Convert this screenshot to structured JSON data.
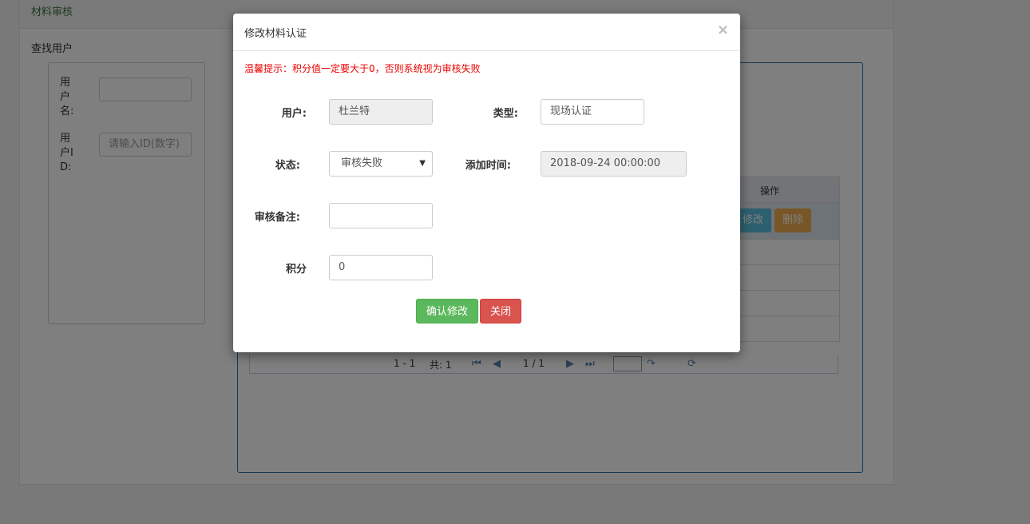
{
  "page": {
    "panel_title": "材料审核",
    "search_title": "查找用户",
    "username_label": "用户名:",
    "userid_label": "用户ID:",
    "userid_placeholder": "请输入ID(数字)",
    "grid": {
      "action_header": "操作",
      "edit_label": "修改",
      "delete_label": "删除",
      "pager": {
        "range": "1 - 1",
        "total": "共: 1",
        "page": "1 / 1"
      }
    }
  },
  "modal": {
    "title": "修改材料认证",
    "close_glyph": "×",
    "tip": "温馨提示：积分值一定要大于0，否则系统视为审核失败",
    "fields": {
      "user_label": "用户:",
      "user_value": "杜兰特",
      "type_label": "类型:",
      "type_value": "现场认证",
      "status_label": "状态:",
      "status_value": "审核失败",
      "time_label": "添加时间:",
      "time_value": "2018-09-24 00:00:00",
      "remark_label": "审核备注:",
      "remark_value": "",
      "score_label": "积分",
      "score_value": "0"
    },
    "confirm_label": "确认修改",
    "close_label": "关闭"
  },
  "icons": [
    "first-page-icon",
    "prev-page-icon",
    "next-page-icon",
    "last-page-icon",
    "go-page-icon",
    "refresh-icon",
    "chevron-down-icon",
    "close-icon"
  ],
  "colors": {
    "tip": "#e00000",
    "confirm": "#5cb85c",
    "close": "#d9534f",
    "edit": "#5bc0de",
    "delete": "#f0ad4e"
  }
}
